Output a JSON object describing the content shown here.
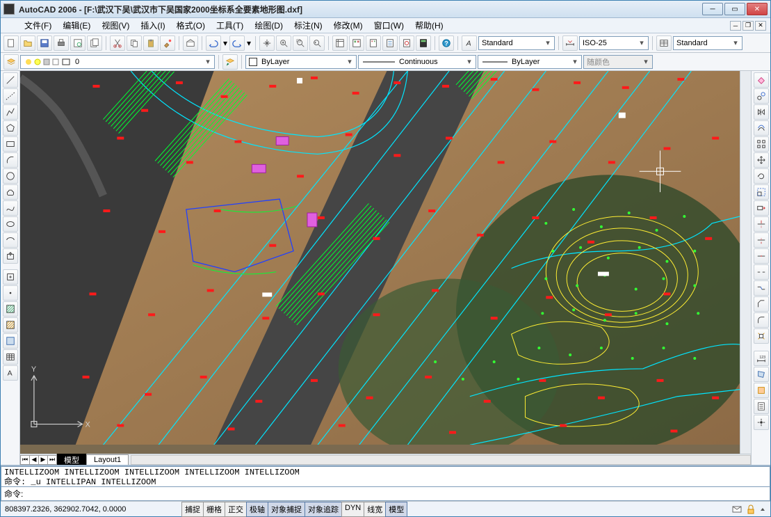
{
  "title": "AutoCAD 2006 - [F:\\武汉下吴\\武汉市下吴国家2000坐标系全要素地形图.dxf]",
  "menus": [
    "文件(F)",
    "编辑(E)",
    "视图(V)",
    "插入(I)",
    "格式(O)",
    "工具(T)",
    "绘图(D)",
    "标注(N)",
    "修改(M)",
    "窗口(W)",
    "帮助(H)"
  ],
  "text_style": {
    "value": "Standard"
  },
  "dim_style": {
    "value": "ISO-25"
  },
  "table_style": {
    "value": "Standard"
  },
  "layer": {
    "value": "0"
  },
  "color": {
    "value": "ByLayer",
    "swatch": "#ffffff"
  },
  "linetype": {
    "value": "Continuous"
  },
  "lineweight": {
    "value": "ByLayer"
  },
  "plotstyle": {
    "value": "随颜色"
  },
  "tabs": {
    "model": "模型",
    "layout1": "Layout1"
  },
  "cmd_history": "INTELLIZOOM INTELLIZOOM INTELLIZOOM INTELLIZOOM INTELLIZOOM\n命令: _u INTELLIPAN INTELLIZOOM",
  "cmd_prompt": "命令:",
  "coords": "808397.2326, 362902.7042, 0.0000",
  "status_buttons": [
    {
      "label": "捕捉",
      "active": false
    },
    {
      "label": "栅格",
      "active": false
    },
    {
      "label": "正交",
      "active": false
    },
    {
      "label": "极轴",
      "active": true
    },
    {
      "label": "对象捕捉",
      "active": true
    },
    {
      "label": "对象追踪",
      "active": true
    },
    {
      "label": "DYN",
      "active": false
    },
    {
      "label": "线宽",
      "active": false
    },
    {
      "label": "模型",
      "active": true
    }
  ],
  "ucs": {
    "x": "X",
    "y": "Y"
  }
}
